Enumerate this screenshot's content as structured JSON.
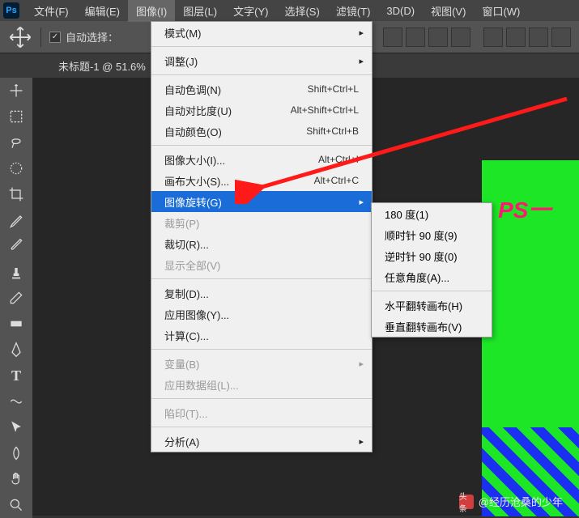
{
  "app": {
    "logo": "Ps"
  },
  "menubar": [
    "文件(F)",
    "编辑(E)",
    "图像(I)",
    "图层(L)",
    "文字(Y)",
    "选择(S)",
    "滤镜(T)",
    "3D(D)",
    "视图(V)",
    "窗口(W)"
  ],
  "toolbar": {
    "auto_select": "自动选择："
  },
  "doc_tab": "未标题-1 @ 51.6%",
  "dropdown": {
    "g1": [
      {
        "label": "模式(M)",
        "fly": true
      }
    ],
    "g2": [
      {
        "label": "调整(J)",
        "fly": true
      }
    ],
    "g3": [
      {
        "label": "自动色调(N)",
        "shortcut": "Shift+Ctrl+L"
      },
      {
        "label": "自动对比度(U)",
        "shortcut": "Alt+Shift+Ctrl+L"
      },
      {
        "label": "自动颜色(O)",
        "shortcut": "Shift+Ctrl+B"
      }
    ],
    "g4": [
      {
        "label": "图像大小(I)...",
        "shortcut": "Alt+Ctrl+I"
      },
      {
        "label": "画布大小(S)...",
        "shortcut": "Alt+Ctrl+C"
      },
      {
        "label": "图像旋转(G)",
        "fly": true,
        "highlight": true
      },
      {
        "label": "裁剪(P)",
        "disabled": true
      },
      {
        "label": "裁切(R)..."
      },
      {
        "label": "显示全部(V)",
        "disabled": true
      }
    ],
    "g5": [
      {
        "label": "复制(D)..."
      },
      {
        "label": "应用图像(Y)..."
      },
      {
        "label": "计算(C)..."
      }
    ],
    "g6": [
      {
        "label": "变量(B)",
        "fly": true,
        "disabled": true
      },
      {
        "label": "应用数据组(L)...",
        "disabled": true
      }
    ],
    "g7": [
      {
        "label": "陷印(T)...",
        "disabled": true
      }
    ],
    "g8": [
      {
        "label": "分析(A)",
        "fly": true
      }
    ]
  },
  "submenu": [
    {
      "label": "180 度(1)"
    },
    {
      "label": "顺时针 90 度(9)"
    },
    {
      "label": "逆时针 90 度(0)"
    },
    {
      "label": "任意角度(A)..."
    },
    {
      "sep": true
    },
    {
      "label": "水平翻转画布(H)"
    },
    {
      "label": "垂直翻转画布(V)"
    }
  ],
  "artwork": {
    "text": "PS一"
  },
  "watermark": {
    "prefix": "头条",
    "author": "@经历沧桑的少年"
  }
}
